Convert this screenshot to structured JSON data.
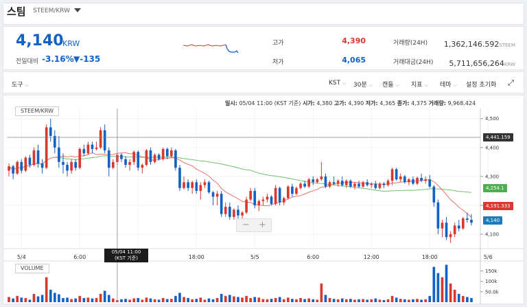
{
  "header": {
    "coin_name": "스팀",
    "pair": "STEEM/KRW"
  },
  "summary": {
    "price": "4,140",
    "unit": "KRW",
    "prev_label": "전일대비",
    "change_pct": "-3.16%",
    "change_abs": "▼-135",
    "high_label": "고가",
    "high": "4,390",
    "low_label": "저가",
    "low": "4,065",
    "vol_label": "거래량(24H)",
    "vol": "1,362,146.592",
    "vol_unit": "STEEM",
    "amt_label": "거래대금(24H)",
    "amt": "5,711,656,264",
    "amt_unit": "KRW"
  },
  "toolbar": {
    "tools": "도구",
    "timezone": "KST",
    "interval": "30분",
    "candle": "캔들",
    "indicator": "지표",
    "theme": "테마",
    "reset": "설정 초기화"
  },
  "info_line": {
    "time_label": "일시:",
    "time": "05/04 11:00 (KST 기준)",
    "open_label": "시가:",
    "open": "4,380",
    "high_label": "고가:",
    "high": "4,390",
    "low_label": "저가:",
    "low": "4,365",
    "close_label": "종가:",
    "close": "4,375",
    "volume_label": "거래량:",
    "volume": "9,968.424"
  },
  "chart_labels": {
    "pair": "STEEM/KRW",
    "volume": "VOLUME",
    "cross_time_1": "05/04 11:00",
    "cross_time_2": "(KST 기준)",
    "tag_crosshair": "4,441.159",
    "tag_ma_long": "4,254.1",
    "tag_ma_short": "4,191.333",
    "tag_price": "4,140",
    "zoom_minus": "−",
    "zoom_plus": "+"
  },
  "colors": {
    "up": "#d9382f",
    "down": "#1261c4",
    "ma_short": "#e9726a",
    "ma_long": "#6cc26c"
  },
  "chart_data": {
    "type": "candlestick",
    "y_ticks": [
      "4,500",
      "4,400",
      "4,300",
      "4,200",
      "4,100"
    ],
    "y_tick_values": [
      4500,
      4400,
      4300,
      4200,
      4100
    ],
    "ylim": [
      4055,
      4535
    ],
    "x_ticks": [
      "5/4",
      "6:00",
      "12:00",
      "18:00",
      "5/5",
      "6:00",
      "12:00",
      "18:00",
      "5/6"
    ],
    "x_tick_index": [
      3,
      17,
      31,
      45,
      59,
      73,
      87,
      101,
      115
    ],
    "vol_ticks": [
      "150k",
      "100k",
      "50.0k"
    ],
    "vol_tick_values": [
      150000,
      100000,
      50000
    ],
    "vol_max": 185000,
    "candles": [
      [
        4320,
        4345,
        4300,
        4335,
        25000
      ],
      [
        4335,
        4340,
        4290,
        4310,
        18000
      ],
      [
        4310,
        4355,
        4305,
        4350,
        30000
      ],
      [
        4350,
        4360,
        4310,
        4320,
        22000
      ],
      [
        4320,
        4370,
        4315,
        4365,
        20000
      ],
      [
        4365,
        4375,
        4330,
        4340,
        12000
      ],
      [
        4340,
        4400,
        4335,
        4390,
        40000
      ],
      [
        4390,
        4410,
        4330,
        4345,
        28000
      ],
      [
        4345,
        4360,
        4310,
        4330,
        35000
      ],
      [
        4330,
        4480,
        4325,
        4470,
        120000
      ],
      [
        4470,
        4500,
        4420,
        4440,
        60000
      ],
      [
        4440,
        4460,
        4380,
        4400,
        45000
      ],
      [
        4400,
        4440,
        4330,
        4350,
        38000
      ],
      [
        4350,
        4380,
        4310,
        4340,
        20000
      ],
      [
        4340,
        4350,
        4300,
        4320,
        22000
      ],
      [
        4320,
        4360,
        4310,
        4350,
        15000
      ],
      [
        4350,
        4360,
        4320,
        4330,
        18000
      ],
      [
        4330,
        4400,
        4325,
        4395,
        30000
      ],
      [
        4395,
        4410,
        4370,
        4380,
        20000
      ],
      [
        4380,
        4420,
        4375,
        4410,
        22000
      ],
      [
        4410,
        4420,
        4380,
        4395,
        18000
      ],
      [
        4395,
        4420,
        4390,
        4400,
        20000
      ],
      [
        4400,
        4470,
        4395,
        4460,
        40000
      ],
      [
        4460,
        4480,
        4380,
        4390,
        55000
      ],
      [
        4390,
        4400,
        4300,
        4330,
        35000
      ],
      [
        4330,
        4360,
        4325,
        4350,
        18000
      ],
      [
        4350,
        4380,
        4340,
        4375,
        9968
      ],
      [
        4375,
        4380,
        4350,
        4360,
        14000
      ],
      [
        4360,
        4370,
        4330,
        4340,
        16000
      ],
      [
        4340,
        4360,
        4320,
        4350,
        12000
      ],
      [
        4350,
        4390,
        4340,
        4385,
        18000
      ],
      [
        4385,
        4390,
        4320,
        4330,
        20000
      ],
      [
        4330,
        4345,
        4310,
        4340,
        12000
      ],
      [
        4340,
        4395,
        4335,
        4390,
        22000
      ],
      [
        4390,
        4400,
        4340,
        4350,
        18000
      ],
      [
        4350,
        4380,
        4345,
        4375,
        14000
      ],
      [
        4375,
        4380,
        4355,
        4360,
        12000
      ],
      [
        4360,
        4400,
        4355,
        4395,
        20000
      ],
      [
        4395,
        4400,
        4360,
        4370,
        15000
      ],
      [
        4370,
        4400,
        4365,
        4390,
        16000
      ],
      [
        4390,
        4395,
        4320,
        4330,
        30000
      ],
      [
        4330,
        4340,
        4250,
        4260,
        45000
      ],
      [
        4260,
        4300,
        4255,
        4280,
        25000
      ],
      [
        4280,
        4290,
        4250,
        4260,
        20000
      ],
      [
        4260,
        4285,
        4240,
        4280,
        14000
      ],
      [
        4280,
        4290,
        4240,
        4250,
        16000
      ],
      [
        4250,
        4280,
        4220,
        4270,
        22000
      ],
      [
        4270,
        4290,
        4260,
        4280,
        12000
      ],
      [
        4280,
        4285,
        4240,
        4245,
        18000
      ],
      [
        4245,
        4250,
        4200,
        4230,
        14000
      ],
      [
        4230,
        4250,
        4200,
        4240,
        20000
      ],
      [
        4240,
        4250,
        4160,
        4170,
        40000
      ],
      [
        4170,
        4210,
        4160,
        4195,
        30000
      ],
      [
        4195,
        4210,
        4150,
        4160,
        35000
      ],
      [
        4160,
        4190,
        4150,
        4185,
        28000
      ],
      [
        4185,
        4200,
        4155,
        4165,
        25000
      ],
      [
        4165,
        4180,
        4140,
        4175,
        22000
      ],
      [
        4175,
        4230,
        4170,
        4220,
        30000
      ],
      [
        4220,
        4260,
        4215,
        4250,
        20000
      ],
      [
        4250,
        4260,
        4190,
        4200,
        25000
      ],
      [
        4200,
        4220,
        4180,
        4215,
        22000
      ],
      [
        4215,
        4230,
        4200,
        4220,
        15000
      ],
      [
        4220,
        4240,
        4210,
        4230,
        14000
      ],
      [
        4230,
        4235,
        4200,
        4205,
        16000
      ],
      [
        4205,
        4270,
        4200,
        4260,
        20000
      ],
      [
        4260,
        4265,
        4200,
        4210,
        25000
      ],
      [
        4210,
        4230,
        4200,
        4225,
        14000
      ],
      [
        4225,
        4270,
        4220,
        4265,
        22000
      ],
      [
        4265,
        4275,
        4230,
        4240,
        16000
      ],
      [
        4240,
        4265,
        4235,
        4260,
        14000
      ],
      [
        4260,
        4280,
        4255,
        4275,
        20000
      ],
      [
        4275,
        4285,
        4260,
        4265,
        15000
      ],
      [
        4265,
        4295,
        4260,
        4290,
        18000
      ],
      [
        4290,
        4300,
        4270,
        4280,
        14000
      ],
      [
        4280,
        4295,
        4275,
        4290,
        12000
      ],
      [
        4290,
        4350,
        4285,
        4300,
        90000
      ],
      [
        4300,
        4310,
        4260,
        4265,
        35000
      ],
      [
        4265,
        4285,
        4260,
        4280,
        20000
      ],
      [
        4280,
        4300,
        4270,
        4275,
        16000
      ],
      [
        4275,
        4290,
        4265,
        4285,
        14000
      ],
      [
        4285,
        4300,
        4265,
        4270,
        18000
      ],
      [
        4270,
        4290,
        4260,
        4285,
        14000
      ],
      [
        4285,
        4290,
        4260,
        4265,
        16000
      ],
      [
        4265,
        4280,
        4255,
        4275,
        12000
      ],
      [
        4275,
        4285,
        4260,
        4265,
        14000
      ],
      [
        4265,
        4285,
        4260,
        4280,
        15000
      ],
      [
        4280,
        4290,
        4265,
        4270,
        12000
      ],
      [
        4270,
        4280,
        4260,
        4275,
        14000
      ],
      [
        4275,
        4285,
        4255,
        4260,
        18000
      ],
      [
        4260,
        4280,
        4255,
        4275,
        12000
      ],
      [
        4275,
        4280,
        4260,
        4270,
        10000
      ],
      [
        4270,
        4290,
        4265,
        4285,
        14000
      ],
      [
        4285,
        4330,
        4270,
        4325,
        30000
      ],
      [
        4325,
        4330,
        4285,
        4290,
        22000
      ],
      [
        4290,
        4310,
        4280,
        4300,
        16000
      ],
      [
        4300,
        4305,
        4275,
        4280,
        14000
      ],
      [
        4280,
        4295,
        4270,
        4290,
        12000
      ],
      [
        4290,
        4300,
        4270,
        4275,
        14000
      ],
      [
        4275,
        4300,
        4270,
        4295,
        16000
      ],
      [
        4295,
        4310,
        4280,
        4285,
        12000
      ],
      [
        4285,
        4300,
        4275,
        4290,
        14000
      ],
      [
        4290,
        4305,
        4260,
        4265,
        30000
      ],
      [
        4265,
        4270,
        4195,
        4210,
        170000
      ],
      [
        4210,
        4220,
        4100,
        4120,
        140000
      ],
      [
        4120,
        4150,
        4090,
        4140,
        120000
      ],
      [
        4140,
        4160,
        4080,
        4090,
        180000
      ],
      [
        4090,
        4110,
        4070,
        4100,
        90000
      ],
      [
        4100,
        4140,
        4090,
        4130,
        60000
      ],
      [
        4130,
        4150,
        4110,
        4120,
        40000
      ],
      [
        4120,
        4160,
        4115,
        4155,
        30000
      ],
      [
        4155,
        4175,
        4140,
        4150,
        25000
      ],
      [
        4150,
        4170,
        4130,
        4140,
        20000
      ]
    ]
  }
}
